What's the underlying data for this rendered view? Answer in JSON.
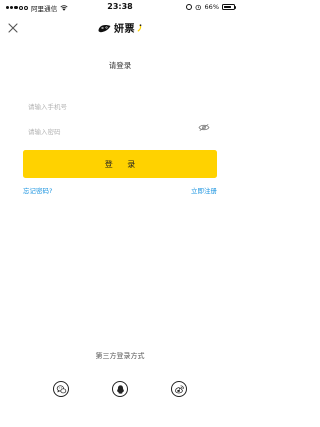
{
  "status_bar": {
    "carrier": "阿里通信",
    "time": "23:38",
    "battery_percent": "66%",
    "battery_level": 0.66,
    "signal_icon": "signal-dots-icon",
    "wifi_icon": "wifi-icon",
    "lock_icon": "rotation-lock-icon",
    "alarm_icon": "alarm-icon"
  },
  "nav": {
    "close_icon": "close-icon",
    "logo_text": "妍票"
  },
  "title": "请登录",
  "form": {
    "phone_placeholder": "请输入手机号",
    "password_placeholder": "请输入密码",
    "eye_icon": "eye-hidden-icon",
    "login_label": "登 录",
    "forgot_label": "忘记密码?",
    "register_label": "立即注册"
  },
  "third_party": {
    "title": "第三方登录方式",
    "providers": [
      {
        "icon": "wechat-icon"
      },
      {
        "icon": "qq-icon"
      },
      {
        "icon": "weibo-icon"
      }
    ]
  },
  "colors": {
    "accent": "#ffd200",
    "link": "#1b94e0",
    "placeholder": "#b3b3b3"
  }
}
